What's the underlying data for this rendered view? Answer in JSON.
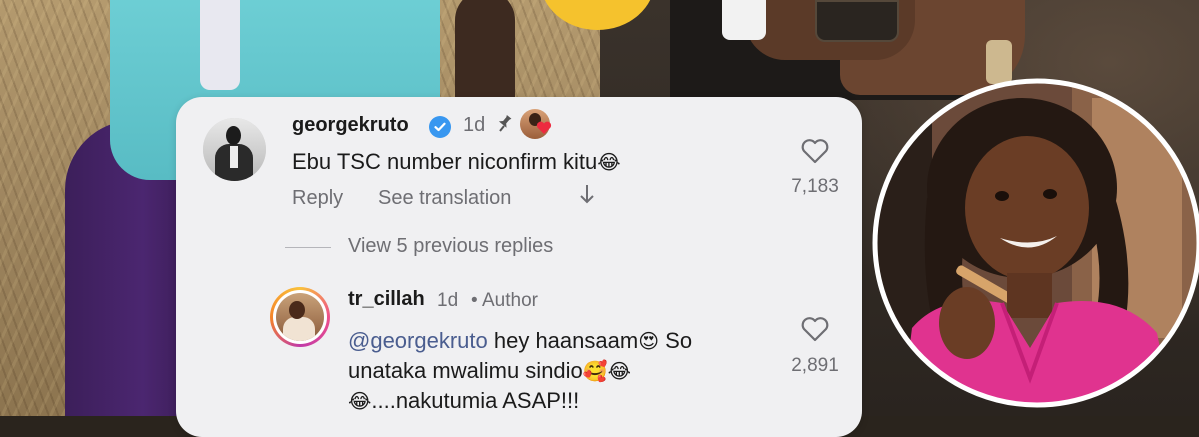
{
  "comment1": {
    "username": "georgekruto",
    "verified": true,
    "time": "1d",
    "pinned": true,
    "liked_by_creator": true,
    "text": "Ebu TSC number niconfirm kitu",
    "text_emoji": "😂",
    "reply_label": "Reply",
    "translation_label": "See translation",
    "likes": "7,183"
  },
  "replies": {
    "view_previous_label": "View 5 previous replies"
  },
  "comment2": {
    "username": "tr_cillah",
    "time": "1d",
    "separator": "•",
    "badge": "Author",
    "mention": "@georgekruto",
    "text_part1": " hey haansaam",
    "emoji1": "😍",
    "text_part2": " So unataka mwalimu sindio",
    "emoji2": "🥰😂",
    "emoji3": "😂",
    "text_part3": "....nakutumia ASAP!!!",
    "likes": "2,891"
  },
  "colors": {
    "card_bg": "#f0f0f2",
    "verified_blue": "#3897f0",
    "mention_color": "#4a5d8f",
    "secondary_text": "#6e6e73"
  },
  "icons": [
    "verified-icon",
    "pin-icon",
    "heart-icon",
    "arrow-down-icon"
  ]
}
